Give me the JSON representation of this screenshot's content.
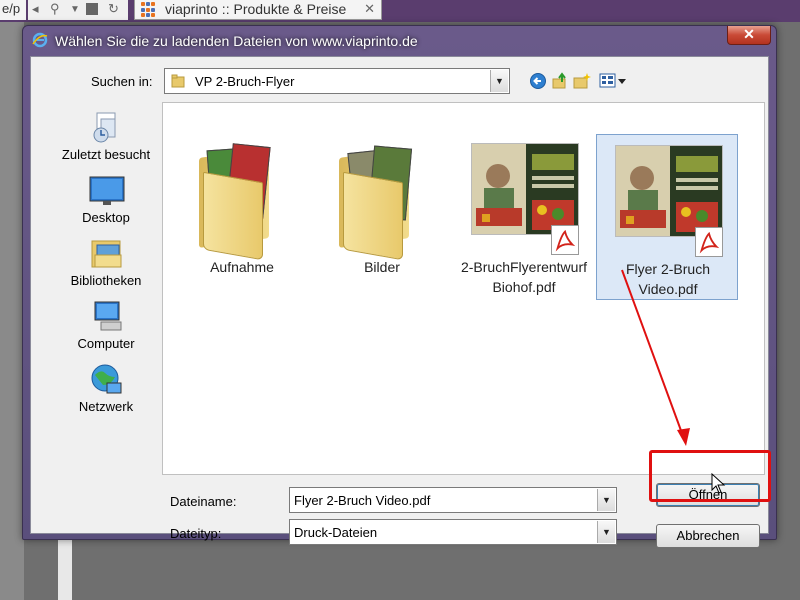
{
  "browser": {
    "url_fragment": "e/p",
    "tab_title": "viaprinto :: Produkte & Preise",
    "tab_close": "✕"
  },
  "dialog": {
    "title": "Wählen Sie die zu ladenden Dateien von www.viaprinto.de",
    "close_glyph": "✕",
    "look_in": {
      "label": "Suchen in:",
      "value": "VP 2-Bruch-Flyer"
    },
    "places": [
      {
        "label": "Zuletzt besucht",
        "icon": "recent-places-icon"
      },
      {
        "label": "Desktop",
        "icon": "desktop-icon"
      },
      {
        "label": "Bibliotheken",
        "icon": "libraries-icon"
      },
      {
        "label": "Computer",
        "icon": "computer-icon"
      },
      {
        "label": "Netzwerk",
        "icon": "network-icon"
      }
    ],
    "files": [
      {
        "name": "Aufnahme",
        "kind": "folder",
        "selected": false
      },
      {
        "name": "Bilder",
        "kind": "folder",
        "selected": false
      },
      {
        "name": "2-BruchFlyerentwurf Biohof.pdf",
        "kind": "pdf",
        "selected": false
      },
      {
        "name": "Flyer 2-Bruch Video.pdf",
        "kind": "pdf",
        "selected": true
      }
    ],
    "filename": {
      "label": "Dateiname:",
      "value": "Flyer 2-Bruch Video.pdf"
    },
    "filetype": {
      "label": "Dateityp:",
      "value": "Druck-Dateien"
    },
    "buttons": {
      "open": "Öffnen",
      "cancel": "Abbrechen"
    }
  },
  "colors": {
    "highlight": "#e01010",
    "selection": "#dce8f7",
    "title_bar": "#6a5a8a"
  }
}
